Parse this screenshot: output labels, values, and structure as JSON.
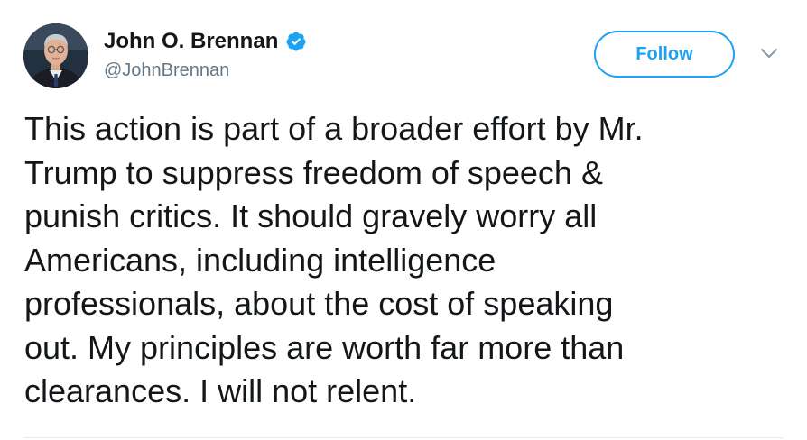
{
  "author": {
    "display_name": "John O. Brennan",
    "handle": "@JohnBrennan",
    "verified": true,
    "avatar_icon": "profile-photo"
  },
  "actions": {
    "follow_label": "Follow",
    "menu_icon": "chevron-down-icon"
  },
  "tweet": {
    "text": "This action is part of a broader effort by Mr.\nTrump to suppress freedom of speech &\npunish critics.  It should gravely worry all\nAmericans, including intelligence\nprofessionals, about the cost of speaking\nout. My principles are worth far more than\nclearances. I will not relent."
  },
  "colors": {
    "accent": "#1da1f2",
    "text_primary": "#14171a",
    "text_secondary": "#657786",
    "divider": "#e6ecf0"
  }
}
